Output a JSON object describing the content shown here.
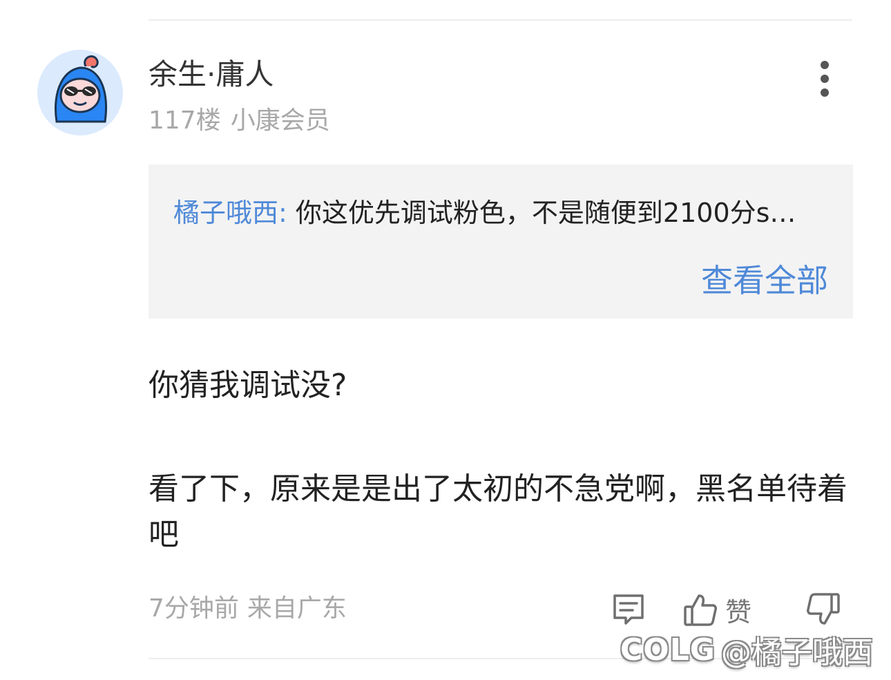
{
  "comment": {
    "username": "余生·庸人",
    "floor": "117楼",
    "member_level": "小康会员",
    "quote": {
      "author": "橘子哦西:",
      "text": "你这优先调试粉色，不是随便到2100分s…",
      "view_all_label": "查看全部"
    },
    "content": {
      "paragraph_1": "你猜我调试没?",
      "paragraph_2": "看了下，原来是是出了太初的不急党啊，黑名单待着吧"
    },
    "time": "7分钟前",
    "location": "来自广东",
    "actions": {
      "like_label": "赞"
    }
  },
  "watermark": {
    "logo": "COLG",
    "text": "@橘子哦西"
  },
  "colors": {
    "accent_blue": "#4f89d8",
    "quote_background": "#f3f3f3",
    "meta_gray": "#a8a8a8",
    "avatar_background": "#dbeafd",
    "avatar_hood": "#2a86f2"
  },
  "icons": {
    "more": "more-vertical-icon",
    "comment": "comment-icon",
    "like": "thumbs-up-icon",
    "dislike": "thumbs-down-icon"
  }
}
